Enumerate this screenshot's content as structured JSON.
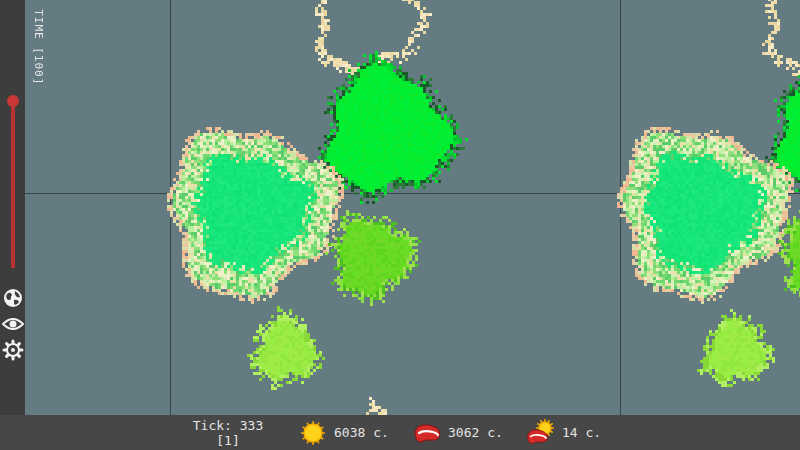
{
  "sidebar": {
    "time_label": "TIME [100]",
    "time_level": 0.97
  },
  "status_bar": {
    "tick": "Tick: 333",
    "speed": "[1]",
    "counters": [
      {
        "kind": "sun",
        "value": "6038 c."
      },
      {
        "kind": "meat",
        "value": "3062 c."
      },
      {
        "kind": "sunmeat",
        "value": "14 c."
      }
    ]
  }
}
